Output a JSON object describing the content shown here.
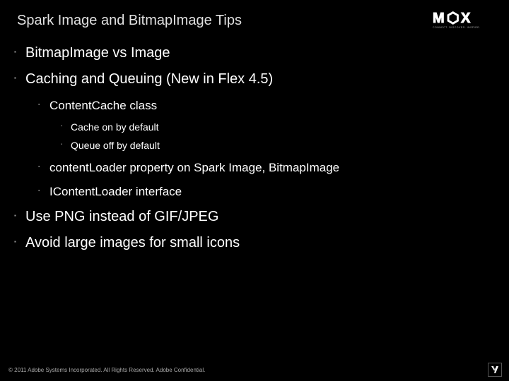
{
  "header": {
    "title": "Spark Image and BitmapImage Tips",
    "logo_text": "MAX",
    "logo_tagline": "CONNECT. DISCOVER. INSPIRE."
  },
  "bullets": {
    "lvl1": [
      "BitmapImage vs Image",
      "Caching and Queuing (New in Flex 4.5)",
      "Use PNG instead of GIF/JPEG",
      "Avoid large images for small icons"
    ],
    "lvl2": [
      "ContentCache class",
      "contentLoader property on Spark Image, BitmapImage",
      "IContentLoader interface"
    ],
    "lvl3": [
      "Cache on by default",
      "Queue off by default"
    ]
  },
  "footer": {
    "copyright": "© 2011 Adobe Systems Incorporated. All Rights Reserved. Adobe Confidential."
  }
}
